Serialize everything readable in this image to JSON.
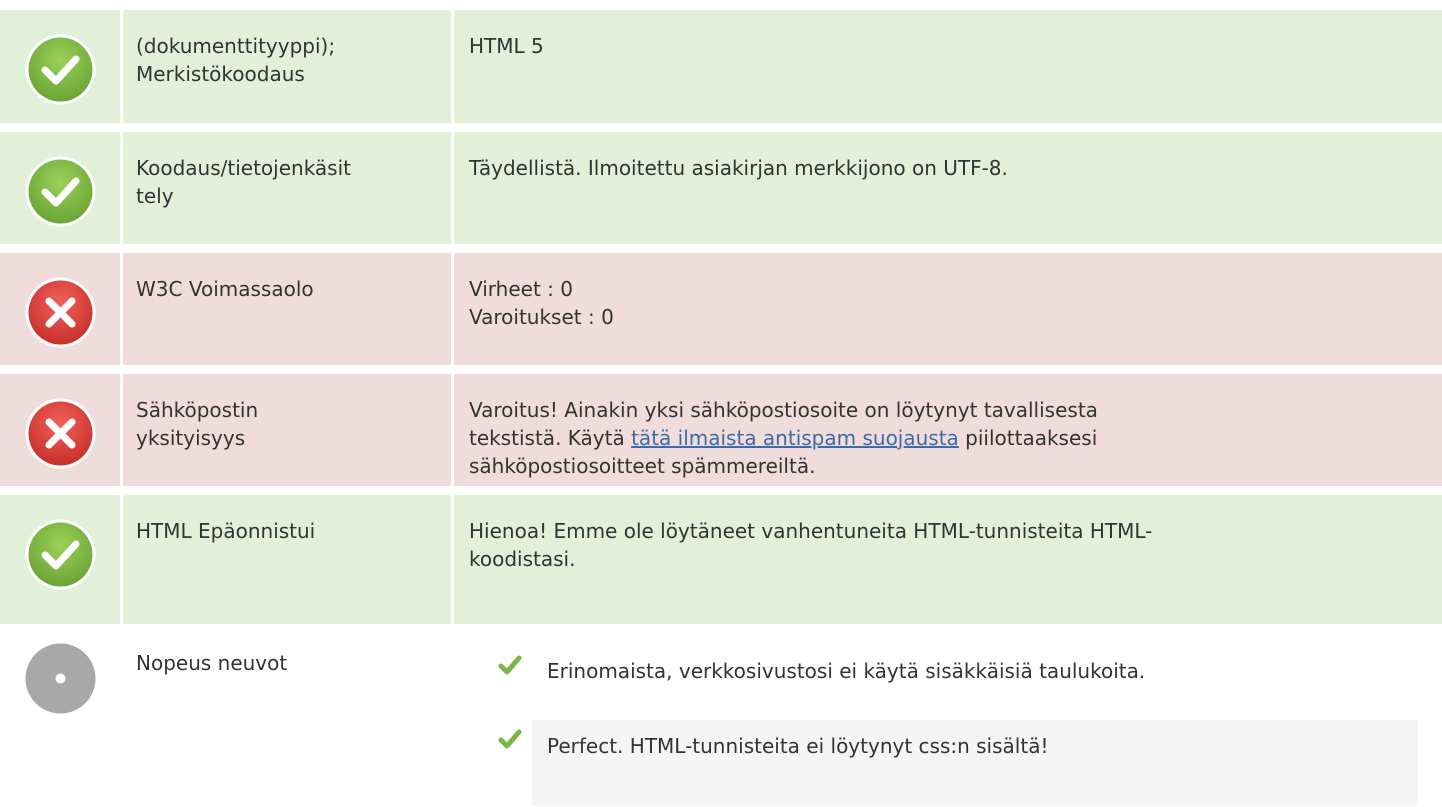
{
  "colors": {
    "pass_bg": "#e2efd9",
    "fail_bg": "#f1dcdc",
    "pass_icon": "#7ab648",
    "fail_icon": "#d9423a",
    "neutral_icon": "#a8a8a8",
    "link": "#3c6aa8",
    "tip_check": "#7ab648"
  },
  "rows": [
    {
      "status": "pass",
      "icon": "check-circle-icon",
      "label_lines": [
        "(dokumenttityyppi);",
        "Merkistökoodaus"
      ],
      "value": "HTML 5"
    },
    {
      "status": "pass",
      "icon": "check-circle-icon",
      "label_lines": [
        "Koodaus/tietojenkäsit",
        "tely"
      ],
      "value": "Täydellistä. Ilmoitettu asiakirjan merkkijono on UTF-8."
    },
    {
      "status": "fail",
      "icon": "x-circle-icon",
      "label": "W3C Voimassaolo",
      "value_lines": [
        "Virheet : 0",
        "Varoitukset : 0"
      ]
    },
    {
      "status": "fail",
      "icon": "x-circle-icon",
      "label_lines": [
        "Sähköpostin",
        "yksityisyys"
      ],
      "value_line1": "Varoitus! Ainakin yksi sähköpostiosoite on löytynyt tavallisesta",
      "value_line2_pre": "tekstistä. Käytä ",
      "value_link": "tätä ilmaista antispam suojausta",
      "value_line2_post": " piilottaaksesi",
      "value_line3": "sähköpostiosoitteet spämmereiltä."
    },
    {
      "status": "pass",
      "icon": "check-circle-icon",
      "label": "HTML Epäonnistui",
      "value_lines": [
        "Hienoa! Emme ole löytäneet vanhentuneita HTML-tunnisteita HTML-",
        "koodistasi."
      ]
    },
    {
      "status": "neutral",
      "icon": "info-circle-icon",
      "label": "Nopeus neuvot",
      "tips": [
        {
          "icon": "checkmark-icon",
          "text": "Erinomaista, verkkosivustosi ei käytä sisäkkäisiä taulukoita."
        },
        {
          "icon": "checkmark-icon",
          "text": "Perfect. HTML-tunnisteita ei löytynyt css:n sisältä!"
        }
      ]
    }
  ]
}
